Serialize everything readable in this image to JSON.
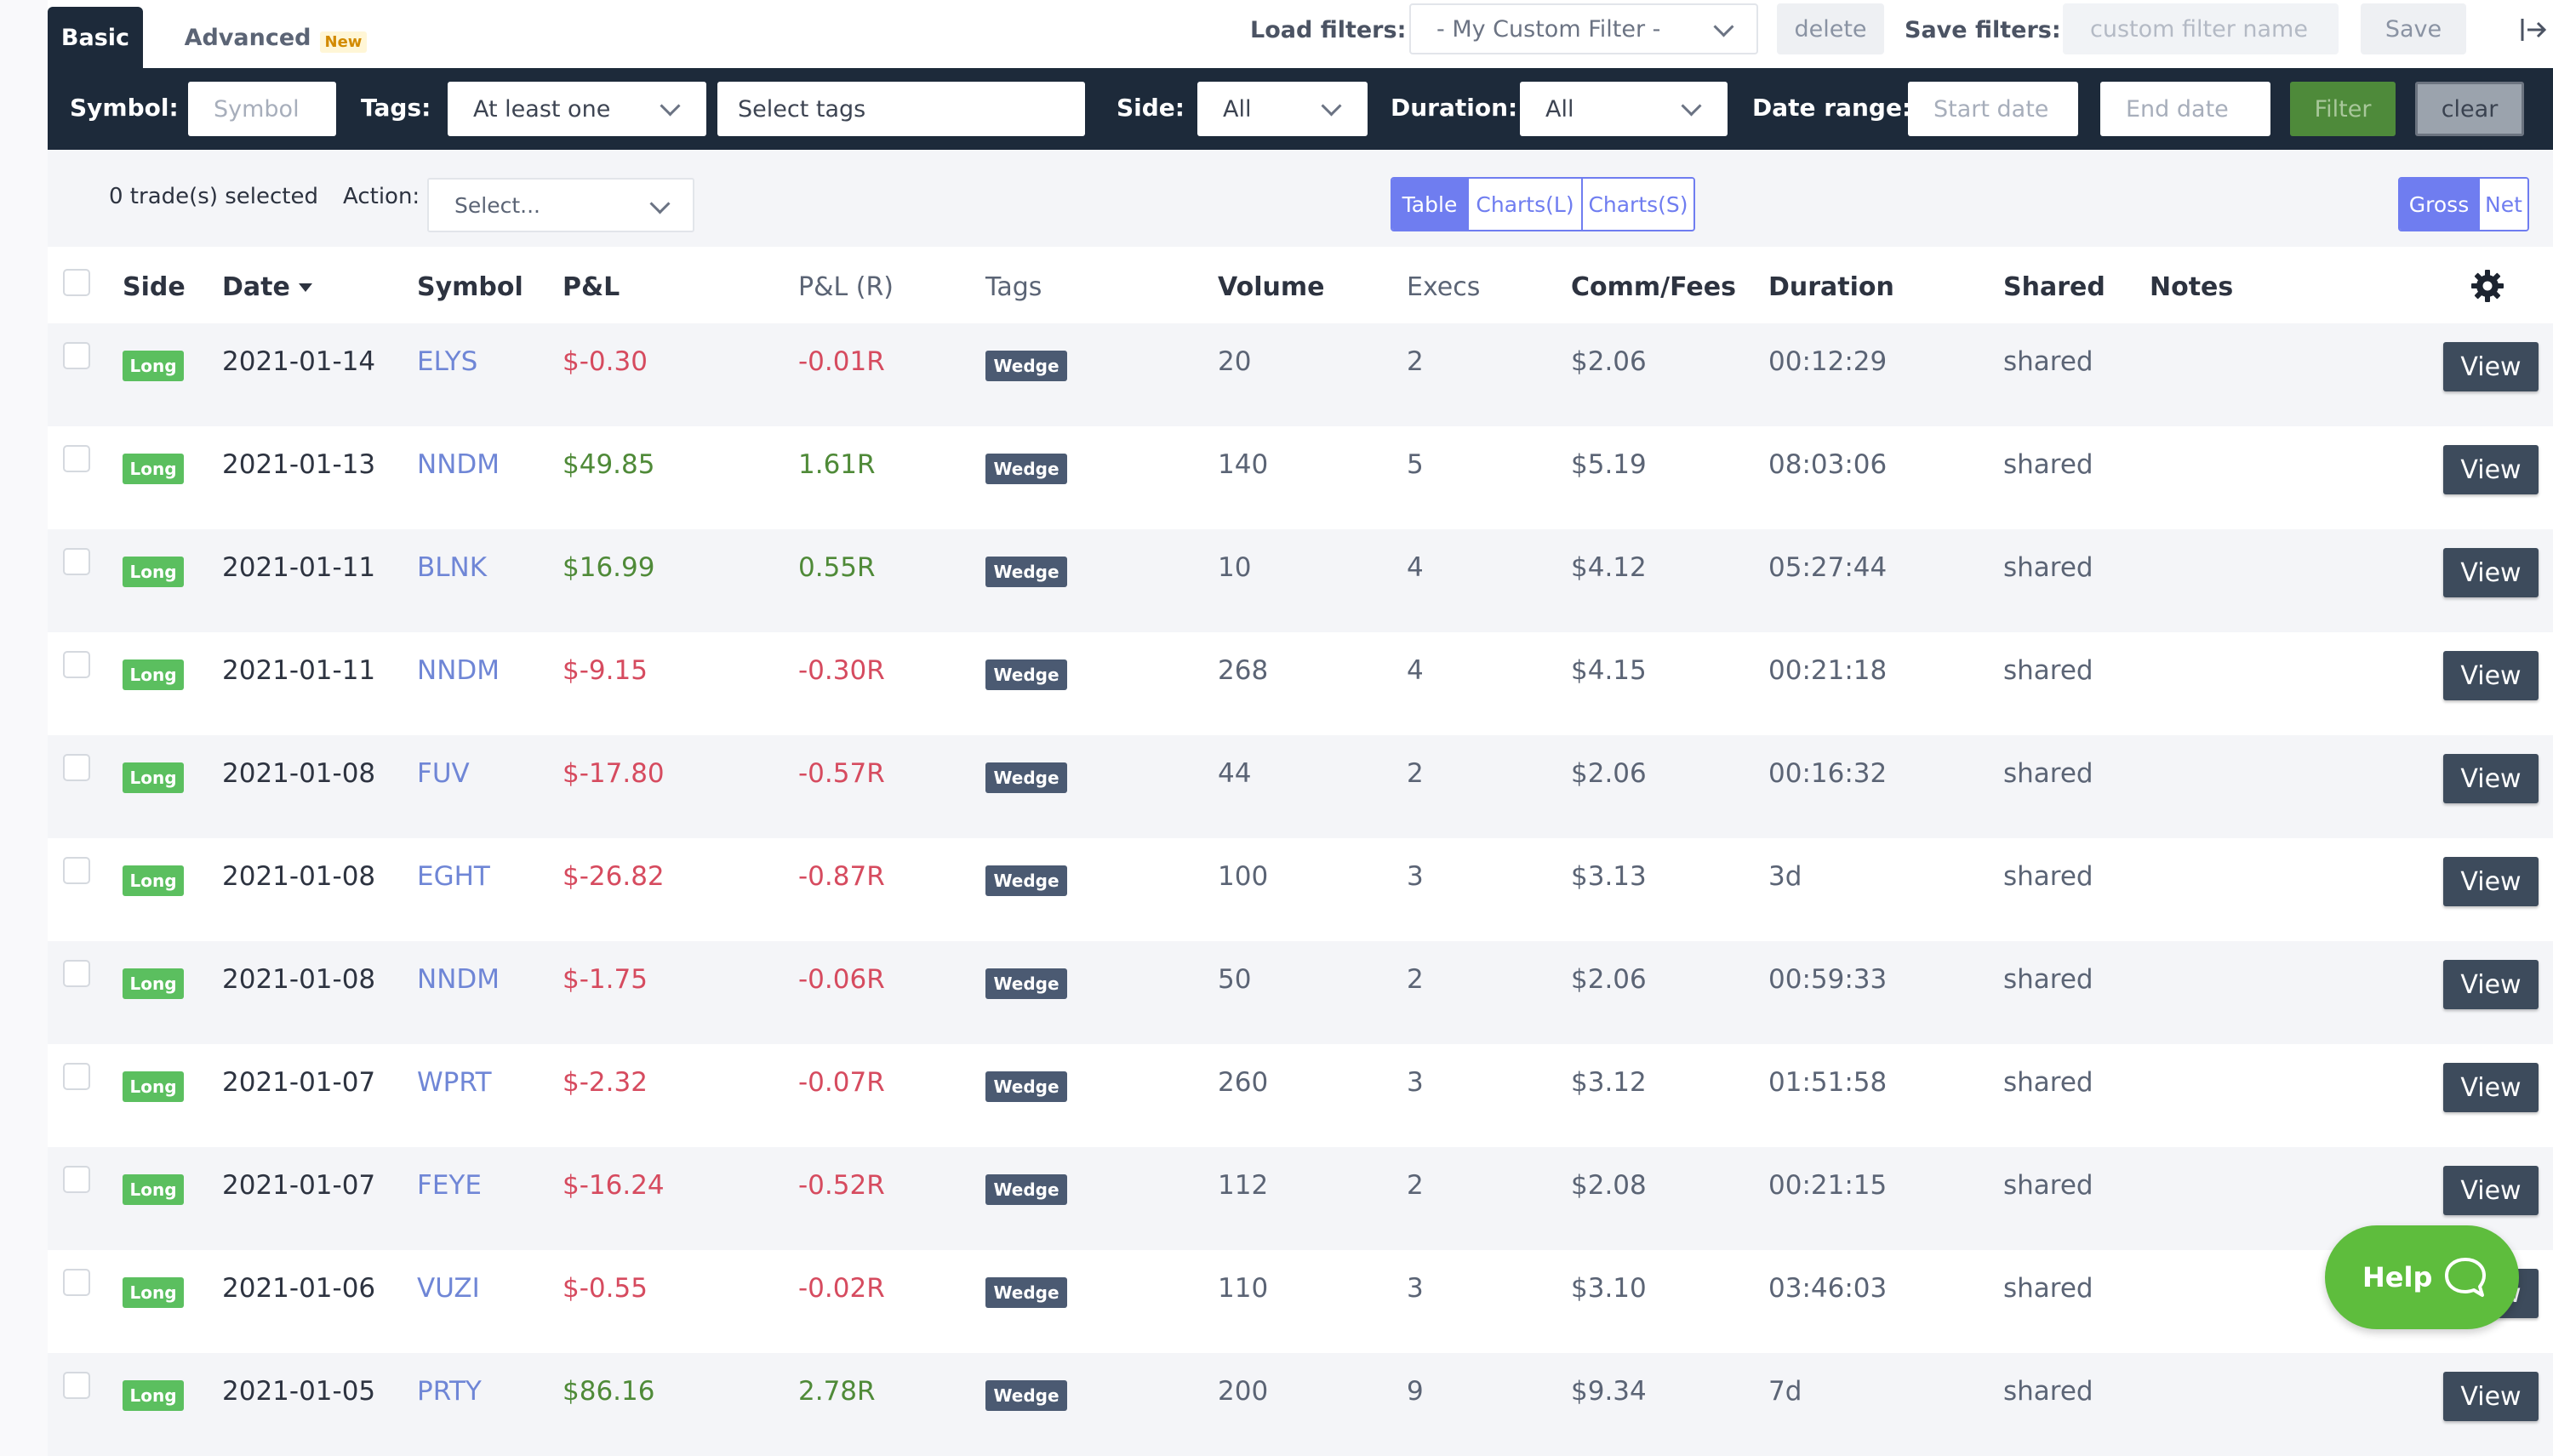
{
  "tabs": {
    "basic": "Basic",
    "advanced": "Advanced",
    "advanced_badge": "New"
  },
  "load_filters": {
    "label": "Load filters:",
    "selected": "- My Custom Filter -",
    "delete": "delete"
  },
  "save_filters": {
    "label": "Save filters:",
    "placeholder": "custom filter name",
    "save": "Save"
  },
  "filters": {
    "symbol_label": "Symbol:",
    "symbol_placeholder": "Symbol",
    "tags_label": "Tags:",
    "tags_mode": "At least one",
    "tags_placeholder": "Select tags",
    "side_label": "Side:",
    "side_value": "All",
    "duration_label": "Duration:",
    "duration_value": "All",
    "date_label": "Date range:",
    "start_placeholder": "Start date",
    "end_placeholder": "End date",
    "filter_btn": "Filter",
    "clear_btn": "clear"
  },
  "actions": {
    "selected_count": "0 trade(s) selected",
    "action_label": "Action:",
    "action_placeholder": "Select...",
    "view_modes": [
      "Table",
      "Charts(L)",
      "Charts(S)"
    ],
    "pnl_modes": [
      "Gross",
      "Net"
    ]
  },
  "columns": [
    "Side",
    "Date",
    "Symbol",
    "P&L",
    "P&L (R)",
    "Tags",
    "Volume",
    "Execs",
    "Comm/Fees",
    "Duration",
    "Shared",
    "Notes"
  ],
  "rows": [
    {
      "side": "Long",
      "date": "2021-01-14",
      "symbol": "ELYS",
      "pnl": "$-0.30",
      "pnl_r": "-0.01R",
      "tag": "Wedge",
      "volume": "20",
      "execs": "2",
      "fees": "$2.06",
      "duration": "00:12:29",
      "shared": "shared",
      "view": "View"
    },
    {
      "side": "Long",
      "date": "2021-01-13",
      "symbol": "NNDM",
      "pnl": "$49.85",
      "pnl_r": "1.61R",
      "tag": "Wedge",
      "volume": "140",
      "execs": "5",
      "fees": "$5.19",
      "duration": "08:03:06",
      "shared": "shared",
      "view": "View"
    },
    {
      "side": "Long",
      "date": "2021-01-11",
      "symbol": "BLNK",
      "pnl": "$16.99",
      "pnl_r": "0.55R",
      "tag": "Wedge",
      "volume": "10",
      "execs": "4",
      "fees": "$4.12",
      "duration": "05:27:44",
      "shared": "shared",
      "view": "View"
    },
    {
      "side": "Long",
      "date": "2021-01-11",
      "symbol": "NNDM",
      "pnl": "$-9.15",
      "pnl_r": "-0.30R",
      "tag": "Wedge",
      "volume": "268",
      "execs": "4",
      "fees": "$4.15",
      "duration": "00:21:18",
      "shared": "shared",
      "view": "View"
    },
    {
      "side": "Long",
      "date": "2021-01-08",
      "symbol": "FUV",
      "pnl": "$-17.80",
      "pnl_r": "-0.57R",
      "tag": "Wedge",
      "volume": "44",
      "execs": "2",
      "fees": "$2.06",
      "duration": "00:16:32",
      "shared": "shared",
      "view": "View"
    },
    {
      "side": "Long",
      "date": "2021-01-08",
      "symbol": "EGHT",
      "pnl": "$-26.82",
      "pnl_r": "-0.87R",
      "tag": "Wedge",
      "volume": "100",
      "execs": "3",
      "fees": "$3.13",
      "duration": "3d",
      "shared": "shared",
      "view": "View"
    },
    {
      "side": "Long",
      "date": "2021-01-08",
      "symbol": "NNDM",
      "pnl": "$-1.75",
      "pnl_r": "-0.06R",
      "tag": "Wedge",
      "volume": "50",
      "execs": "2",
      "fees": "$2.06",
      "duration": "00:59:33",
      "shared": "shared",
      "view": "View"
    },
    {
      "side": "Long",
      "date": "2021-01-07",
      "symbol": "WPRT",
      "pnl": "$-2.32",
      "pnl_r": "-0.07R",
      "tag": "Wedge",
      "volume": "260",
      "execs": "3",
      "fees": "$3.12",
      "duration": "01:51:58",
      "shared": "shared",
      "view": "View"
    },
    {
      "side": "Long",
      "date": "2021-01-07",
      "symbol": "FEYE",
      "pnl": "$-16.24",
      "pnl_r": "-0.52R",
      "tag": "Wedge",
      "volume": "112",
      "execs": "2",
      "fees": "$2.08",
      "duration": "00:21:15",
      "shared": "shared",
      "view": "View"
    },
    {
      "side": "Long",
      "date": "2021-01-06",
      "symbol": "VUZI",
      "pnl": "$-0.55",
      "pnl_r": "-0.02R",
      "tag": "Wedge",
      "volume": "110",
      "execs": "3",
      "fees": "$3.10",
      "duration": "03:46:03",
      "shared": "shared",
      "view": "View"
    },
    {
      "side": "Long",
      "date": "2021-01-05",
      "symbol": "PRTY",
      "pnl": "$86.16",
      "pnl_r": "2.78R",
      "tag": "Wedge",
      "volume": "200",
      "execs": "9",
      "fees": "$9.34",
      "duration": "7d",
      "shared": "shared",
      "view": "View"
    }
  ],
  "help": {
    "label": "Help"
  },
  "icons": {
    "settings": "gear-icon",
    "exit": "logout-icon",
    "help": "chat-bubble-icon",
    "sort": "sort-desc-icon"
  },
  "colors": {
    "nav_dark": "#1d2a3a",
    "profit": "#4f8a38",
    "loss": "#d64b5f",
    "symbol": "#6f86d6",
    "accent": "#6f7df0",
    "help": "#5ebd3d"
  }
}
